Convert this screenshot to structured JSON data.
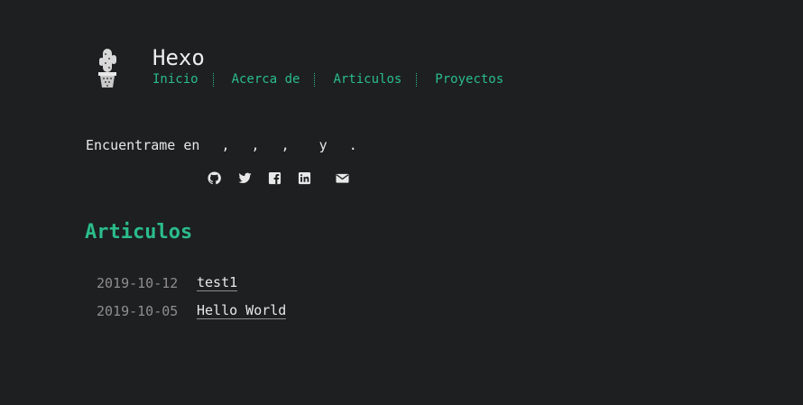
{
  "header": {
    "title": "Hexo",
    "logo_icon": "cactus-icon",
    "nav": [
      {
        "label": "Inicio"
      },
      {
        "label": "Acerca de"
      },
      {
        "label": "Articulos"
      },
      {
        "label": "Proyectos"
      }
    ]
  },
  "social": {
    "prefix": "Encuentrame en ",
    "sep": ", ",
    "and": " y ",
    "end": ".",
    "icons": [
      "github-icon",
      "twitter-icon",
      "facebook-icon",
      "linkedin-icon",
      "mail-icon"
    ]
  },
  "section": {
    "title": "Articulos"
  },
  "posts": [
    {
      "date": "2019-10-12",
      "title": "test1"
    },
    {
      "date": "2019-10-05",
      "title": "Hello World"
    }
  ],
  "colors": {
    "background": "#1d1f21",
    "accent": "#2bbc8a",
    "text": "#c9cacc",
    "muted": "#908d8d"
  }
}
